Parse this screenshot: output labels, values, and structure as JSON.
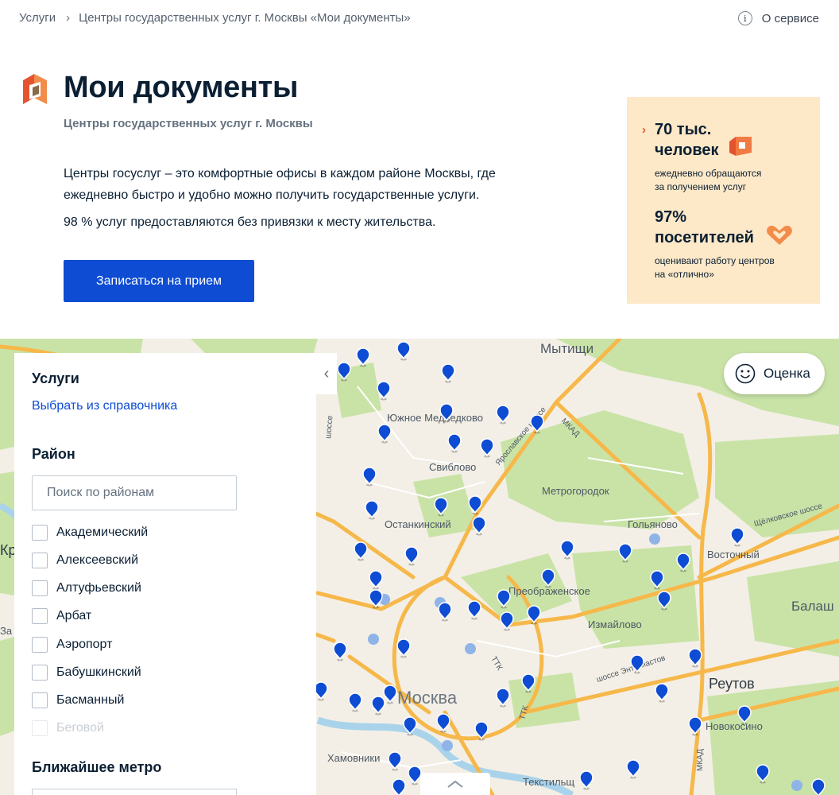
{
  "breadcrumbs": [
    "Услуги",
    "Центры государственных услуг г. Москвы «Мои документы»"
  ],
  "about": {
    "icon": "info-icon",
    "label": "О сервисе"
  },
  "hero": {
    "title": "Мои документы",
    "subtitle": "Центры государственных услуг г. Москвы",
    "description": "Центры госуслуг – это комфортные офисы в каждом районе Москвы, где ежедневно быстро и удобно можно получить государственные услуги.",
    "note": "98 % услуг предоставляются без привязки к месту жительства.",
    "cta_label": "Записаться на прием"
  },
  "stats": {
    "first_big_1": "70 тыс.",
    "first_big_2": "человек",
    "first_small_1": "ежедневно обращаются",
    "first_small_2": "за получением услуг",
    "second_big_1": "97%",
    "second_big_2": "посетителей",
    "second_small_1": "оценивают работу центров",
    "second_small_2": "на «отлично»"
  },
  "filter_panel": {
    "services_heading": "Услуги",
    "services_link": "Выбрать из справочника",
    "district_heading": "Район",
    "district_placeholder": "Поиск по районам",
    "districts": [
      "Академический",
      "Алексеевский",
      "Алтуфьевский",
      "Арбат",
      "Аэропорт",
      "Бабушкинский",
      "Басманный",
      "Беговой"
    ],
    "metro_heading": "Ближайшее метро"
  },
  "map": {
    "rating_label": "Оценка",
    "labels": {
      "mytishchi": "Мытищи",
      "yuzhnoe_medvedkovo": "Южное Медведково",
      "sviblovo": "Свиблово",
      "metrogorodok": "Метрогородок",
      "ostankinsky": "Останкинский",
      "golyanovo": "Гольяново",
      "vostochny": "Восточный",
      "preobrazhenskoe": "Преображенское",
      "izmaylovo": "Измайлово",
      "balash": "Балаш",
      "reutov": "Реутов",
      "moskva": "Москва",
      "novokosino": "Новокосино",
      "khamovniki": "Хамовники",
      "tekstilshchiki": "Текстильщ",
      "mkad_1": "МКАД",
      "mkad_2": "МКАД",
      "ttk_1": "ТТК",
      "ttk_2": "ТТК",
      "yaroslavskoe": "Ярославское шоссе",
      "shchelkovskoe": "Щёлковское шоссе",
      "entuziastov": "шоссе Энтузиастов",
      "shosse_left": "шоссе",
      "kr": "Кр",
      "za": "За"
    },
    "accent_color": "#0d4cd3"
  }
}
